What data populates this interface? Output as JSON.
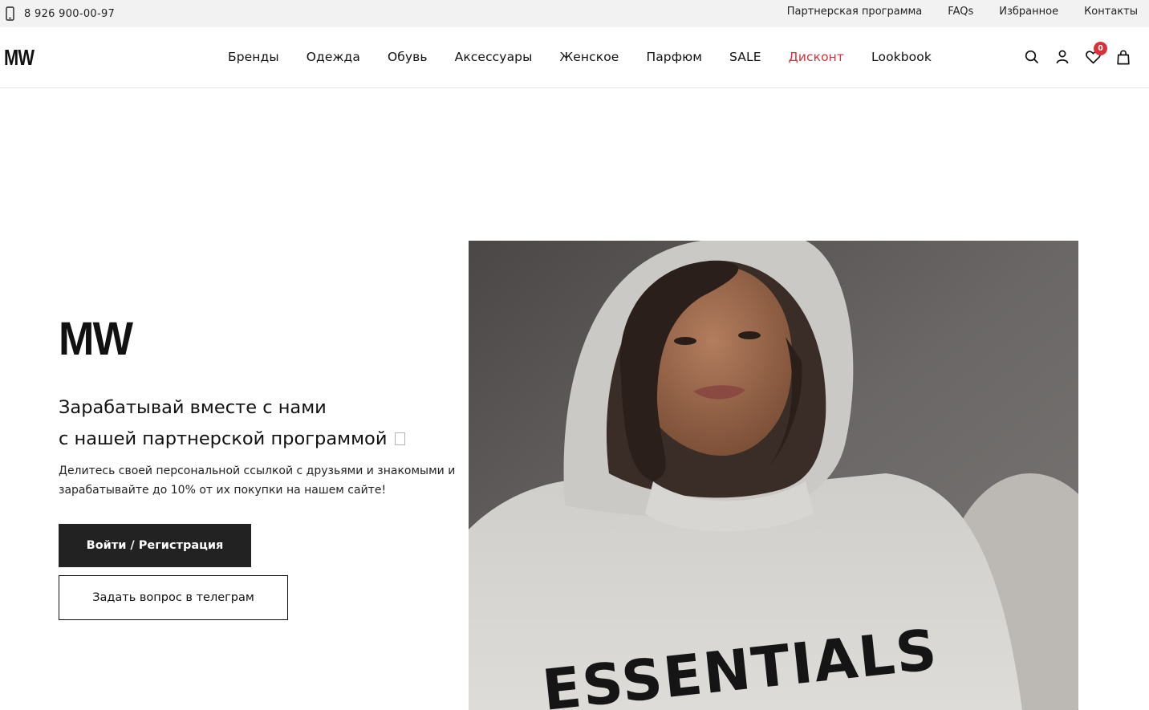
{
  "topbar": {
    "phone": "8 926 900-00-97",
    "links": [
      "Партнерская программа",
      "FAQs",
      "Избранное",
      "Контакты"
    ]
  },
  "header": {
    "logo": "MW",
    "nav": [
      "Бренды",
      "Одежда",
      "Обувь",
      "Аксессуары",
      "Женское",
      "Парфюм",
      "SALE",
      "Дисконт",
      "Lookbook"
    ],
    "favorites_count": "0",
    "icons": [
      "search-icon",
      "user-icon",
      "heart-icon",
      "bag-icon"
    ]
  },
  "hero": {
    "logo": "MW",
    "title_line1": "Зарабатывай вместе с нами",
    "title_line2": "с нашей партнерской программой",
    "description": "Делитесь своей персональной ссылкой с друзьями и знакомыми и зарабатывайте до 10% от их покупки на нашем сайте!",
    "primary_button": "Войти / Регистрация",
    "secondary_button": "Задать вопрос в телеграм",
    "image_print": "ESSENTIALS"
  },
  "colors": {
    "accent": "#d9303a",
    "dark_button": "#222222",
    "topbar_bg": "#f2f2f2"
  }
}
